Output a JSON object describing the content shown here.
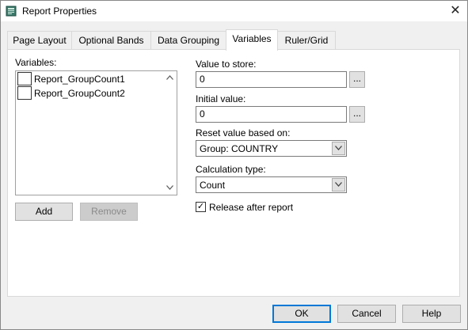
{
  "window": {
    "title": "Report Properties",
    "close_glyph": "✕",
    "icon": "report-icon"
  },
  "tabs": [
    {
      "label": "Page Layout",
      "active": false
    },
    {
      "label": "Optional Bands",
      "active": false
    },
    {
      "label": "Data Grouping",
      "active": false
    },
    {
      "label": "Variables",
      "active": true
    },
    {
      "label": "Ruler/Grid",
      "active": false
    }
  ],
  "variables": {
    "label": "Variables:",
    "items": [
      {
        "name": "Report_GroupCount1",
        "checked": false
      },
      {
        "name": "Report_GroupCount2",
        "checked": false
      }
    ],
    "add_label": "Add",
    "remove_label": "Remove"
  },
  "form": {
    "value_to_store": {
      "label": "Value to store:",
      "value": "0",
      "button": "..."
    },
    "initial_value": {
      "label": "Initial value:",
      "value": "0",
      "button": "..."
    },
    "reset_value": {
      "label": "Reset value based on:",
      "selected": "Group: COUNTRY"
    },
    "calculation_type": {
      "label": "Calculation type:",
      "selected": "Count"
    },
    "release_after_report": {
      "label": "Release after report",
      "checked": true,
      "mark": "✓"
    }
  },
  "footer": {
    "ok_label": "OK",
    "cancel_label": "Cancel",
    "help_label": "Help"
  },
  "colors": {
    "accent": "#0078d7",
    "background": "#f0f0f0"
  }
}
